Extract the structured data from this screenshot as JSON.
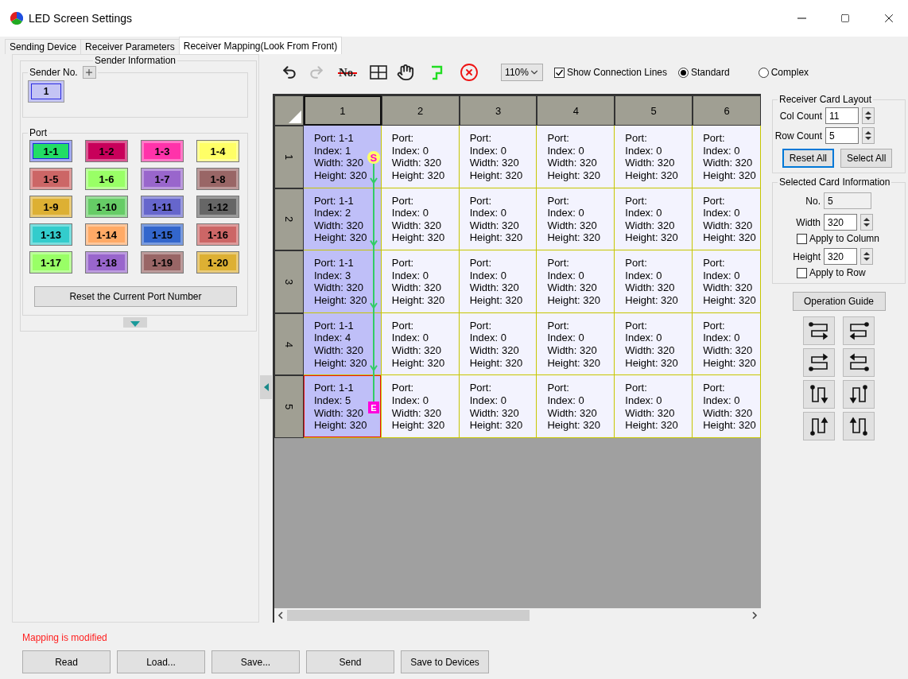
{
  "window": {
    "title": "LED Screen Settings"
  },
  "tabs": [
    {
      "label": "Sending Device",
      "selected": false
    },
    {
      "label": "Receiver Parameters",
      "selected": false
    },
    {
      "label": "Receiver Mapping(Look From Front)",
      "selected": true
    }
  ],
  "sender_info": {
    "title": "Sender Information",
    "sender_no_label": "Sender No.",
    "senders": [
      {
        "label": "1",
        "selected": true
      }
    ],
    "port_label": "Port",
    "reset_button": "Reset the Current Port Number",
    "ports": [
      {
        "label": "1-1",
        "color": "#22dd66",
        "selected": true
      },
      {
        "label": "1-2",
        "color": "#c8005a",
        "selected": false
      },
      {
        "label": "1-3",
        "color": "#ff33aa",
        "selected": false
      },
      {
        "label": "1-4",
        "color": "#ffff66",
        "selected": false
      },
      {
        "label": "1-5",
        "color": "#cc6666",
        "selected": false
      },
      {
        "label": "1-6",
        "color": "#99ff66",
        "selected": false
      },
      {
        "label": "1-7",
        "color": "#9966cc",
        "selected": false
      },
      {
        "label": "1-8",
        "color": "#996666",
        "selected": false
      },
      {
        "label": "1-9",
        "color": "#ddb033",
        "selected": false
      },
      {
        "label": "1-10",
        "color": "#66cc66",
        "selected": false
      },
      {
        "label": "1-11",
        "color": "#6666cc",
        "selected": false
      },
      {
        "label": "1-12",
        "color": "#666666",
        "selected": false
      },
      {
        "label": "1-13",
        "color": "#33cccc",
        "selected": false
      },
      {
        "label": "1-14",
        "color": "#ffaa66",
        "selected": false
      },
      {
        "label": "1-15",
        "color": "#3366cc",
        "selected": false
      },
      {
        "label": "1-16",
        "color": "#cc6666",
        "selected": false
      },
      {
        "label": "1-17",
        "color": "#99ff66",
        "selected": false
      },
      {
        "label": "1-18",
        "color": "#9966cc",
        "selected": false
      },
      {
        "label": "1-19",
        "color": "#996666",
        "selected": false
      },
      {
        "label": "1-20",
        "color": "#ddb033",
        "selected": false
      }
    ]
  },
  "toolbar": {
    "items": [
      {
        "kind": "undo",
        "disabled": false
      },
      {
        "kind": "redo",
        "disabled": true
      },
      {
        "kind": "separator"
      },
      {
        "kind": "number",
        "label": "No.",
        "disabled": false
      },
      {
        "kind": "separator"
      },
      {
        "kind": "grid",
        "disabled": false
      },
      {
        "kind": "hand",
        "disabled": false
      },
      {
        "kind": "separator"
      },
      {
        "kind": "route",
        "disabled": false
      },
      {
        "kind": "separator"
      },
      {
        "kind": "clear",
        "disabled": false
      }
    ],
    "zoom": "110%",
    "show_connection_lines": {
      "label": "Show Connection Lines",
      "checked": true
    },
    "modes": [
      {
        "label": "Standard",
        "selected": true
      },
      {
        "label": "Complex",
        "selected": false
      }
    ]
  },
  "grid": {
    "columns": [
      {
        "label": "1",
        "selected": true
      },
      {
        "label": "2",
        "selected": false
      },
      {
        "label": "3",
        "selected": false
      },
      {
        "label": "4",
        "selected": false
      },
      {
        "label": "5",
        "selected": false
      },
      {
        "label": "6",
        "selected": false
      }
    ],
    "rows": [
      {
        "label": "1",
        "cells": [
          {
            "lines": [
              "Port: 1-1",
              "Index: 1",
              "Width: 320",
              "Height: 320"
            ],
            "assigned": true,
            "selected": false,
            "marker": {
              "kind": "start",
              "label": "S"
            }
          },
          {
            "lines": [
              "Port:",
              "Index: 0",
              "Width: 320",
              "Height: 320"
            ],
            "assigned": false,
            "selected": false
          },
          {
            "lines": [
              "Port:",
              "Index: 0",
              "Width: 320",
              "Height: 320"
            ],
            "assigned": false,
            "selected": false
          },
          {
            "lines": [
              "Port:",
              "Index: 0",
              "Width: 320",
              "Height: 320"
            ],
            "assigned": false,
            "selected": false
          },
          {
            "lines": [
              "Port:",
              "Index: 0",
              "Width: 320",
              "Height: 320"
            ],
            "assigned": false,
            "selected": false
          },
          {
            "lines": [
              "Port:",
              "Index: 0",
              "Width: 320",
              "Height: 320"
            ],
            "assigned": false,
            "selected": false
          }
        ]
      },
      {
        "label": "2",
        "cells": [
          {
            "lines": [
              "Port: 1-1",
              "Index: 2",
              "Width: 320",
              "Height: 320"
            ],
            "assigned": true,
            "selected": false
          },
          {
            "lines": [
              "Port:",
              "Index: 0",
              "Width: 320",
              "Height: 320"
            ],
            "assigned": false,
            "selected": false
          },
          {
            "lines": [
              "Port:",
              "Index: 0",
              "Width: 320",
              "Height: 320"
            ],
            "assigned": false,
            "selected": false
          },
          {
            "lines": [
              "Port:",
              "Index: 0",
              "Width: 320",
              "Height: 320"
            ],
            "assigned": false,
            "selected": false
          },
          {
            "lines": [
              "Port:",
              "Index: 0",
              "Width: 320",
              "Height: 320"
            ],
            "assigned": false,
            "selected": false
          },
          {
            "lines": [
              "Port:",
              "Index: 0",
              "Width: 320",
              "Height: 320"
            ],
            "assigned": false,
            "selected": false
          }
        ]
      },
      {
        "label": "3",
        "cells": [
          {
            "lines": [
              "Port: 1-1",
              "Index: 3",
              "Width: 320",
              "Height: 320"
            ],
            "assigned": true,
            "selected": false
          },
          {
            "lines": [
              "Port:",
              "Index: 0",
              "Width: 320",
              "Height: 320"
            ],
            "assigned": false,
            "selected": false
          },
          {
            "lines": [
              "Port:",
              "Index: 0",
              "Width: 320",
              "Height: 320"
            ],
            "assigned": false,
            "selected": false
          },
          {
            "lines": [
              "Port:",
              "Index: 0",
              "Width: 320",
              "Height: 320"
            ],
            "assigned": false,
            "selected": false
          },
          {
            "lines": [
              "Port:",
              "Index: 0",
              "Width: 320",
              "Height: 320"
            ],
            "assigned": false,
            "selected": false
          },
          {
            "lines": [
              "Port:",
              "Index: 0",
              "Width: 320",
              "Height: 320"
            ],
            "assigned": false,
            "selected": false
          }
        ]
      },
      {
        "label": "4",
        "cells": [
          {
            "lines": [
              "Port: 1-1",
              "Index: 4",
              "Width: 320",
              "Height: 320"
            ],
            "assigned": true,
            "selected": false
          },
          {
            "lines": [
              "Port:",
              "Index: 0",
              "Width: 320",
              "Height: 320"
            ],
            "assigned": false,
            "selected": false
          },
          {
            "lines": [
              "Port:",
              "Index: 0",
              "Width: 320",
              "Height: 320"
            ],
            "assigned": false,
            "selected": false
          },
          {
            "lines": [
              "Port:",
              "Index: 0",
              "Width: 320",
              "Height: 320"
            ],
            "assigned": false,
            "selected": false
          },
          {
            "lines": [
              "Port:",
              "Index: 0",
              "Width: 320",
              "Height: 320"
            ],
            "assigned": false,
            "selected": false
          },
          {
            "lines": [
              "Port:",
              "Index: 0",
              "Width: 320",
              "Height: 320"
            ],
            "assigned": false,
            "selected": false
          }
        ]
      },
      {
        "label": "5",
        "cells": [
          {
            "lines": [
              "Port: 1-1",
              "Index: 5",
              "Width: 320",
              "Height: 320"
            ],
            "assigned": true,
            "selected": true,
            "marker": {
              "kind": "end",
              "label": "E"
            }
          },
          {
            "lines": [
              "Port:",
              "Index: 0",
              "Width: 320",
              "Height: 320"
            ],
            "assigned": false,
            "selected": false
          },
          {
            "lines": [
              "Port:",
              "Index: 0",
              "Width: 320",
              "Height: 320"
            ],
            "assigned": false,
            "selected": false
          },
          {
            "lines": [
              "Port:",
              "Index: 0",
              "Width: 320",
              "Height: 320"
            ],
            "assigned": false,
            "selected": false
          },
          {
            "lines": [
              "Port:",
              "Index: 0",
              "Width: 320",
              "Height: 320"
            ],
            "assigned": false,
            "selected": false
          },
          {
            "lines": [
              "Port:",
              "Index: 0",
              "Width: 320",
              "Height: 320"
            ],
            "assigned": false,
            "selected": false
          }
        ]
      }
    ]
  },
  "card_layout": {
    "title": "Receiver Card Layout",
    "col_count": {
      "label": "Col Count",
      "value": "11"
    },
    "row_count": {
      "label": "Row Count",
      "value": "5"
    },
    "buttons": [
      {
        "label": "Reset All",
        "focused": true
      },
      {
        "label": "Select All",
        "focused": false
      }
    ]
  },
  "selected_card": {
    "title": "Selected Card Information",
    "no": {
      "label": "No.",
      "value": "5"
    },
    "width": {
      "label": "Width",
      "value": "320"
    },
    "apply_column": {
      "label": "Apply to Column",
      "checked": false
    },
    "height": {
      "label": "Height",
      "value": "320"
    },
    "apply_row": {
      "label": "Apply to Row",
      "checked": false
    }
  },
  "operation_guide": "Operation Guide",
  "status": "Mapping is modified",
  "buttons": [
    "Read",
    "Load...",
    "Save...",
    "Send",
    "Save to Devices"
  ]
}
